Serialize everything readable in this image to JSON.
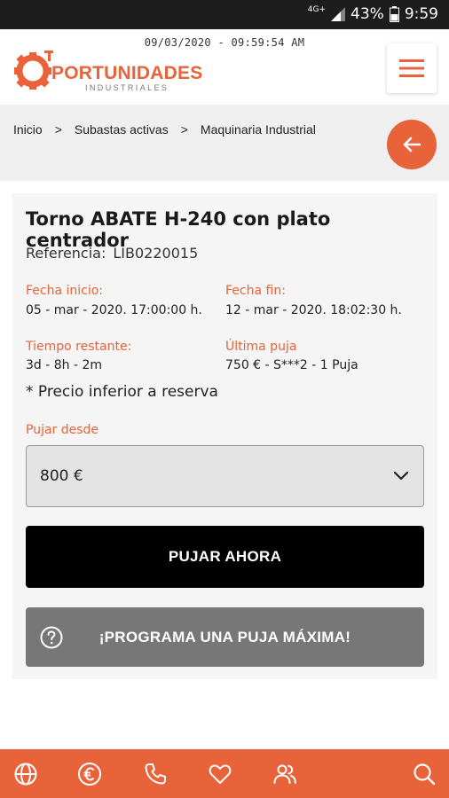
{
  "status_bar": {
    "network": "4G+",
    "battery": "43%",
    "time": "9:59"
  },
  "header": {
    "datetime": "09/03/2020 - 09:59:54 AM",
    "logo": {
      "title": "PORTUNIDADES",
      "subtitle": "INDUSTRIALES"
    }
  },
  "breadcrumb": {
    "items": [
      "Inicio",
      ">",
      "Subastas activas",
      ">",
      "Maquinaria Industrial"
    ]
  },
  "auction": {
    "title": "Torno ABATE H-240 con plato centrador",
    "reference_label": "Referencia:",
    "reference_value": "LIB0220015",
    "start_label": "Fecha inicio:",
    "start_value": "05 - mar - 2020. 17:00:00 h.",
    "end_label": "Fecha fin:",
    "end_value": "12 - mar - 2020. 18:02:30 h.",
    "remaining_label": "Tiempo restante:",
    "remaining_value": "3d - 8h - 2m",
    "last_bid_label": "Última puja",
    "last_bid_value": "750 € - S***2 - 1 Puja",
    "reserve_note": "* Precio inferior a reserva",
    "bid_from_label": "Pujar desde",
    "bid_selected": "800 €",
    "bid_button": "PUJAR AHORA",
    "max_bid_button": "¡PROGRAMA UNA PUJA MÁXIMA!"
  },
  "bottom_nav": {
    "icons": [
      "globe-icon",
      "euro-icon",
      "phone-icon",
      "heart-icon",
      "users-icon",
      "search-icon"
    ]
  },
  "colors": {
    "accent": "#e8633a",
    "dark": "#000000",
    "grey_button": "#777777",
    "background_grey": "#efefef"
  }
}
